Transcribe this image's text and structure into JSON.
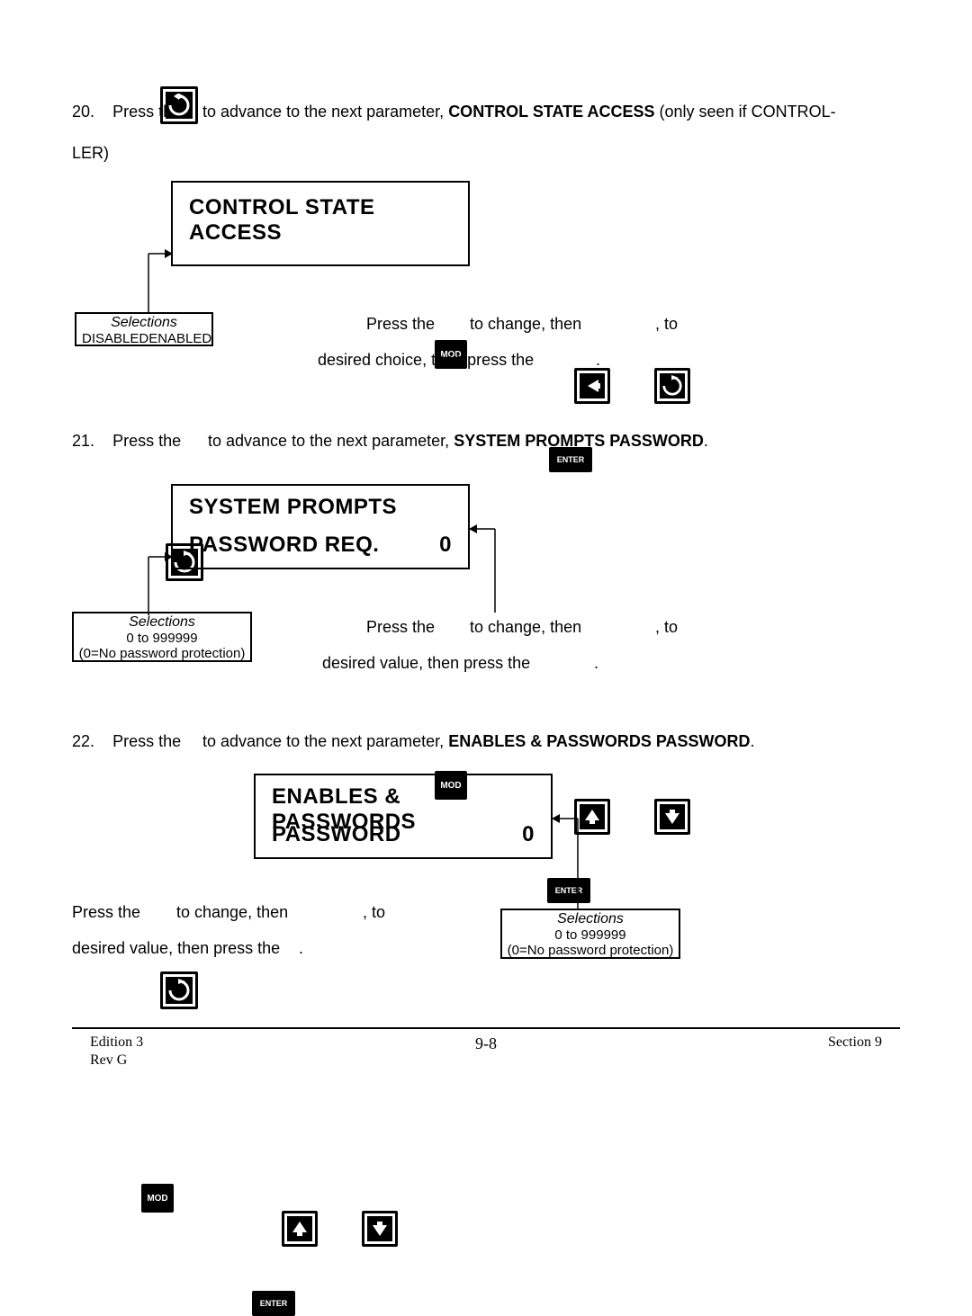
{
  "steps": {
    "s20": {
      "num": "20.",
      "pre": "Press the",
      "post1": "to advance to the next parameter, ",
      "bold": "CONTROL STATE ACCESS",
      "post2": " (only seen if CONTROL-",
      "wrap": "LER)"
    },
    "s21": {
      "num": "21.",
      "pre": "Press the ",
      "post1": "to advance to the next parameter, ",
      "bold": "SYSTEM PROMPTS PASSWORD",
      "post2": "."
    },
    "s22": {
      "num": "22.",
      "pre": "Press the",
      "post1": "to advance to the next parameter, ",
      "bold": "ENABLES & PASSWORDS PASSWORD",
      "post2": "."
    }
  },
  "panels": {
    "p1": {
      "line1": "CONTROL STATE ACCESS"
    },
    "p2": {
      "line1": "SYSTEM  PROMPTS",
      "line2": "PASSWORD REQ.",
      "value": "0"
    },
    "p3": {
      "line1": "ENABLES  &  PASSWORDS",
      "line2": "PASSWORD",
      "value": "0"
    }
  },
  "selections": {
    "label": "Selections",
    "sel1a": "DISABLED",
    "sel1b": "ENABLED",
    "sel2a": "0 to 999999",
    "sel2b": "(0=No password protection)",
    "sel3a": "0 to 999999",
    "sel3b": "(0=No password protection)"
  },
  "instr": {
    "press_the": "Press the ",
    "to_change_then": "to change, then",
    "comma_to": ", to",
    "desired_choice": "desired choice, then press the",
    "desired_value": "desired value, then press the",
    "period": "."
  },
  "key_labels": {
    "mod": "MOD",
    "enter": "ENTER"
  },
  "footer": {
    "pagenum": "9-8",
    "left1": "Edition 3",
    "left2": "Rev G",
    "right": "Section 9"
  }
}
